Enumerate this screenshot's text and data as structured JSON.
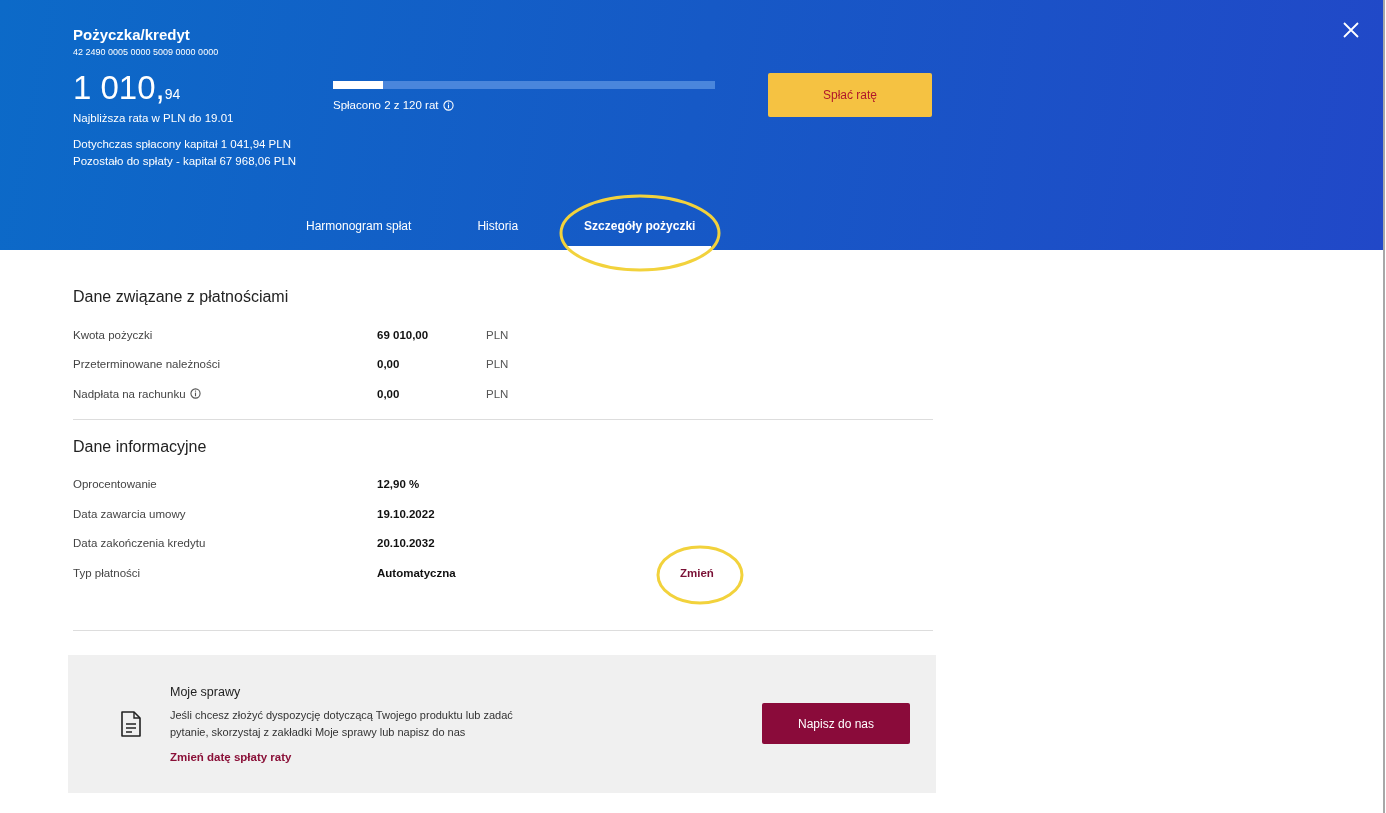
{
  "header": {
    "title": "Pożyczka/kredyt",
    "account_number": "42 2490 0005 0000 5009 0000 0000",
    "amount_main": "1 010,",
    "amount_fraction": "94",
    "amount_caption": "Najbliższa rata w PLN do 19.01",
    "repaid_capital": "Dotychczas spłacony kapitał 1 041,94 PLN",
    "remaining_capital": "Pozostało do spłaty - kapitał 67 968,06 PLN",
    "progress": {
      "level": 0.13,
      "label": "Spłacono 2 z 120 rat"
    },
    "pay_button": "Spłać ratę"
  },
  "tabs": [
    {
      "label": "Harmonogram spłat",
      "selected": false,
      "circled": false
    },
    {
      "label": "Historia",
      "selected": false,
      "circled": false
    },
    {
      "label": "Szczegóły pożyczki",
      "selected": true,
      "circled": true
    }
  ],
  "sections": [
    {
      "title": "Dane związane z płatnościami",
      "rows": [
        {
          "label": "Kwota pożyczki",
          "value": "69 010,00",
          "unit": "PLN",
          "info": false
        },
        {
          "label": "Przeterminowane należności",
          "value": "0,00",
          "unit": "PLN",
          "info": false
        },
        {
          "label": "Nadpłata na rachunku",
          "value": "0,00",
          "unit": "PLN",
          "info": true
        }
      ]
    },
    {
      "title": "Dane informacyjne",
      "rows": [
        {
          "label": "Oprocentowanie",
          "value": "12,90 %",
          "info": false
        },
        {
          "label": "Data zawarcia umowy",
          "value": "19.10.2022",
          "info": false
        },
        {
          "label": "Data zakończenia kredytu",
          "value": "20.10.2032",
          "info": false
        },
        {
          "label": "Typ płatności",
          "value": "Automatyczna",
          "info": false,
          "action": {
            "label": "Zmień",
            "circled": true
          }
        }
      ]
    }
  ],
  "cases": {
    "title": "Moje sprawy",
    "text": "Jeśli chcesz złożyć dyspozycję dotyczącą Twojego produktu lub zadać pytanie, skorzystaj z zakładki Moje sprawy lub napisz do nas",
    "link": "Zmień datę spłaty raty",
    "button": "Napisz do nas"
  }
}
